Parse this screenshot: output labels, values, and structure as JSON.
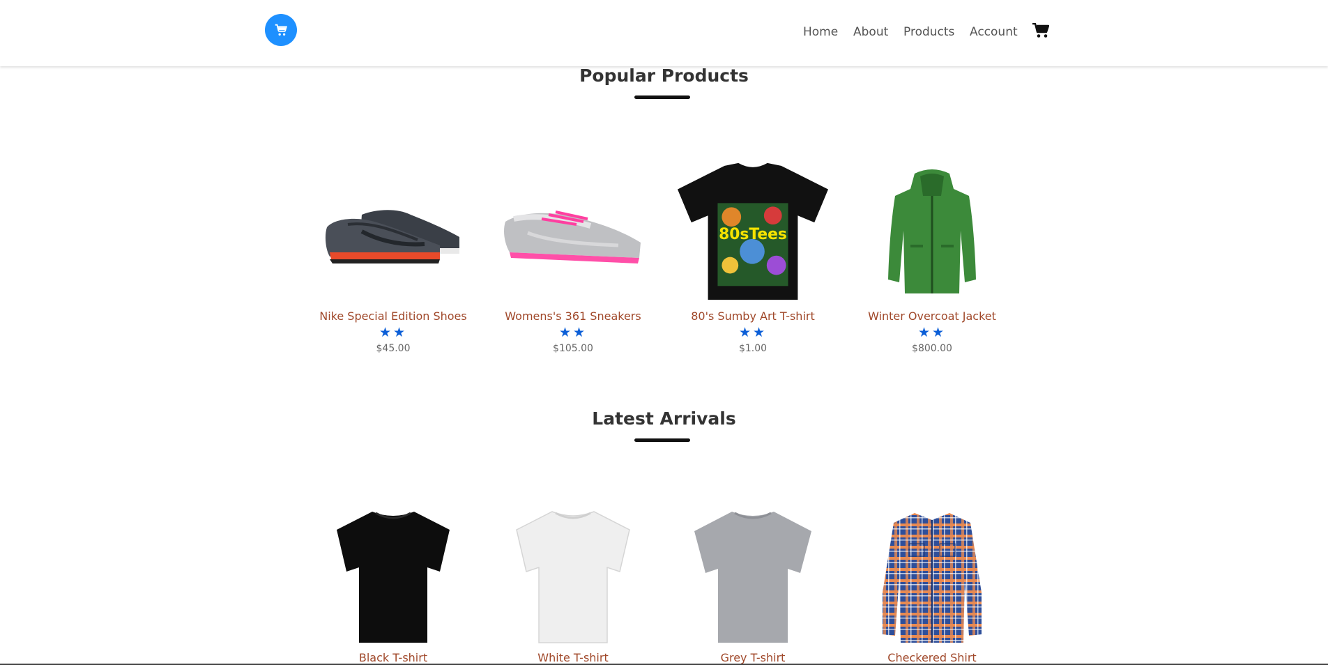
{
  "nav": {
    "logo_icon": "shopping-cart-icon",
    "links": [
      {
        "label": "Home"
      },
      {
        "label": "About"
      },
      {
        "label": "Products"
      },
      {
        "label": "Account"
      }
    ],
    "cart_icon": "shopping-cart-icon"
  },
  "colors": {
    "logo_bg": "#1e90ff",
    "product_name": "#a0482a",
    "star": "#0b5ed7"
  },
  "popular": {
    "title": "Popular Products",
    "products": [
      {
        "name": "Nike Special Edition Shoes",
        "rating": 2,
        "price": "$45.00",
        "image": "sneaker-dark-icon"
      },
      {
        "name": "Womens's 361 Sneakers",
        "rating": 2,
        "price": "$105.00",
        "image": "sneaker-pink-icon"
      },
      {
        "name": "80's Sumby Art T-shirt",
        "rating": 2,
        "price": "$1.00",
        "image": "tshirt-printed-icon"
      },
      {
        "name": "Winter Overcoat Jacket",
        "rating": 2,
        "price": "$800.00",
        "image": "jacket-icon"
      }
    ]
  },
  "latest": {
    "title": "Latest Arrivals",
    "products": [
      {
        "name": "Black T-shirt",
        "image": "tshirt-black-icon"
      },
      {
        "name": "White T-shirt",
        "image": "tshirt-white-icon"
      },
      {
        "name": "Grey T-shirt",
        "image": "tshirt-grey-icon"
      },
      {
        "name": "Checkered Shirt",
        "image": "checkered-shirt-icon"
      }
    ]
  }
}
